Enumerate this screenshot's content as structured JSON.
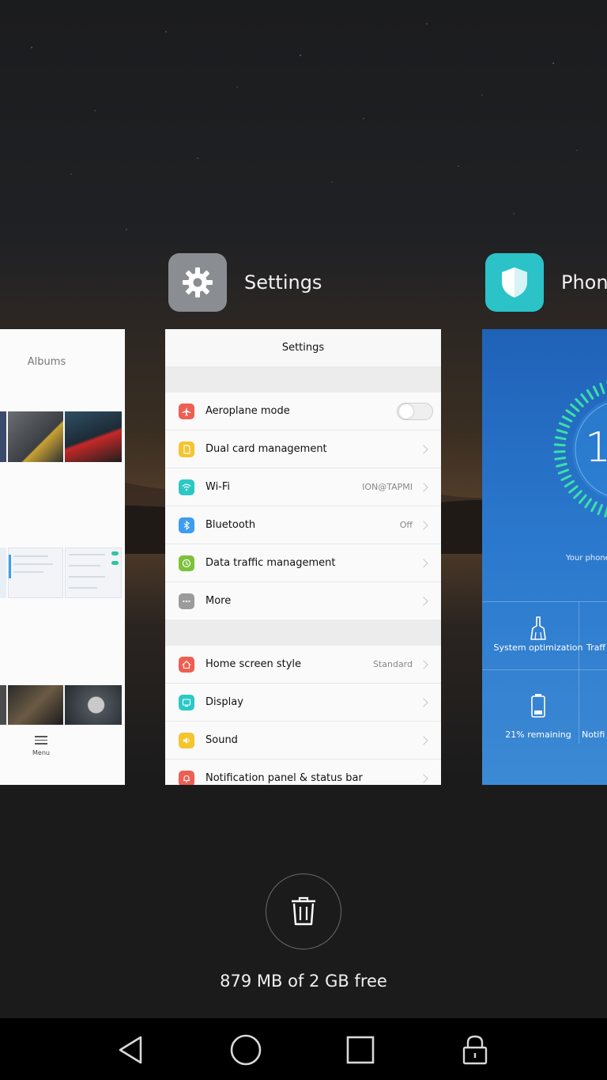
{
  "apps": {
    "left": {
      "title": "Albums",
      "menu_label": "Menu"
    },
    "center": {
      "title": "Settings",
      "card_title": "Settings",
      "items_group1": [
        {
          "label": "Aeroplane mode",
          "value": "",
          "color": "#ef5e52",
          "icon": "airplane-icon",
          "control": "toggle"
        },
        {
          "label": "Dual card management",
          "value": "",
          "color": "#f6c42d",
          "icon": "sim-card-icon",
          "control": "chevron"
        },
        {
          "label": "Wi-Fi",
          "value": "ION@TAPMI",
          "color": "#2cc8c4",
          "icon": "wifi-icon",
          "control": "chevron"
        },
        {
          "label": "Bluetooth",
          "value": "Off",
          "color": "#3d9df0",
          "icon": "bluetooth-icon",
          "control": "chevron"
        },
        {
          "label": "Data traffic management",
          "value": "",
          "color": "#7cc23b",
          "icon": "data-traffic-icon",
          "control": "chevron"
        },
        {
          "label": "More",
          "value": "",
          "color": "#9b9b9b",
          "icon": "more-icon",
          "control": "chevron"
        }
      ],
      "items_group2": [
        {
          "label": "Home screen style",
          "value": "Standard",
          "color": "#ef5e52",
          "icon": "home-icon",
          "control": "chevron"
        },
        {
          "label": "Display",
          "value": "",
          "color": "#2cc8c4",
          "icon": "display-icon",
          "control": "chevron"
        },
        {
          "label": "Sound",
          "value": "",
          "color": "#f6c42d",
          "icon": "sound-icon",
          "control": "chevron"
        },
        {
          "label": "Notification panel & status bar",
          "value": "",
          "color": "#ef5e52",
          "icon": "notification-icon",
          "control": "chevron"
        }
      ]
    },
    "right": {
      "title": "Phon",
      "big_digit": "1",
      "status_text": "Your phone",
      "tiles": [
        {
          "label": "System optimization",
          "icon": "broom-icon"
        },
        {
          "label": "Traff"
        },
        {
          "label": "21% remaining",
          "icon": "battery-icon"
        },
        {
          "label": "Notifi"
        }
      ]
    }
  },
  "memory": {
    "text": "879 MB of 2 GB free"
  },
  "colors": {
    "settings_icon_bg": "#8a8d91",
    "phone_manager_icon_bg": "#2bc2c8"
  }
}
